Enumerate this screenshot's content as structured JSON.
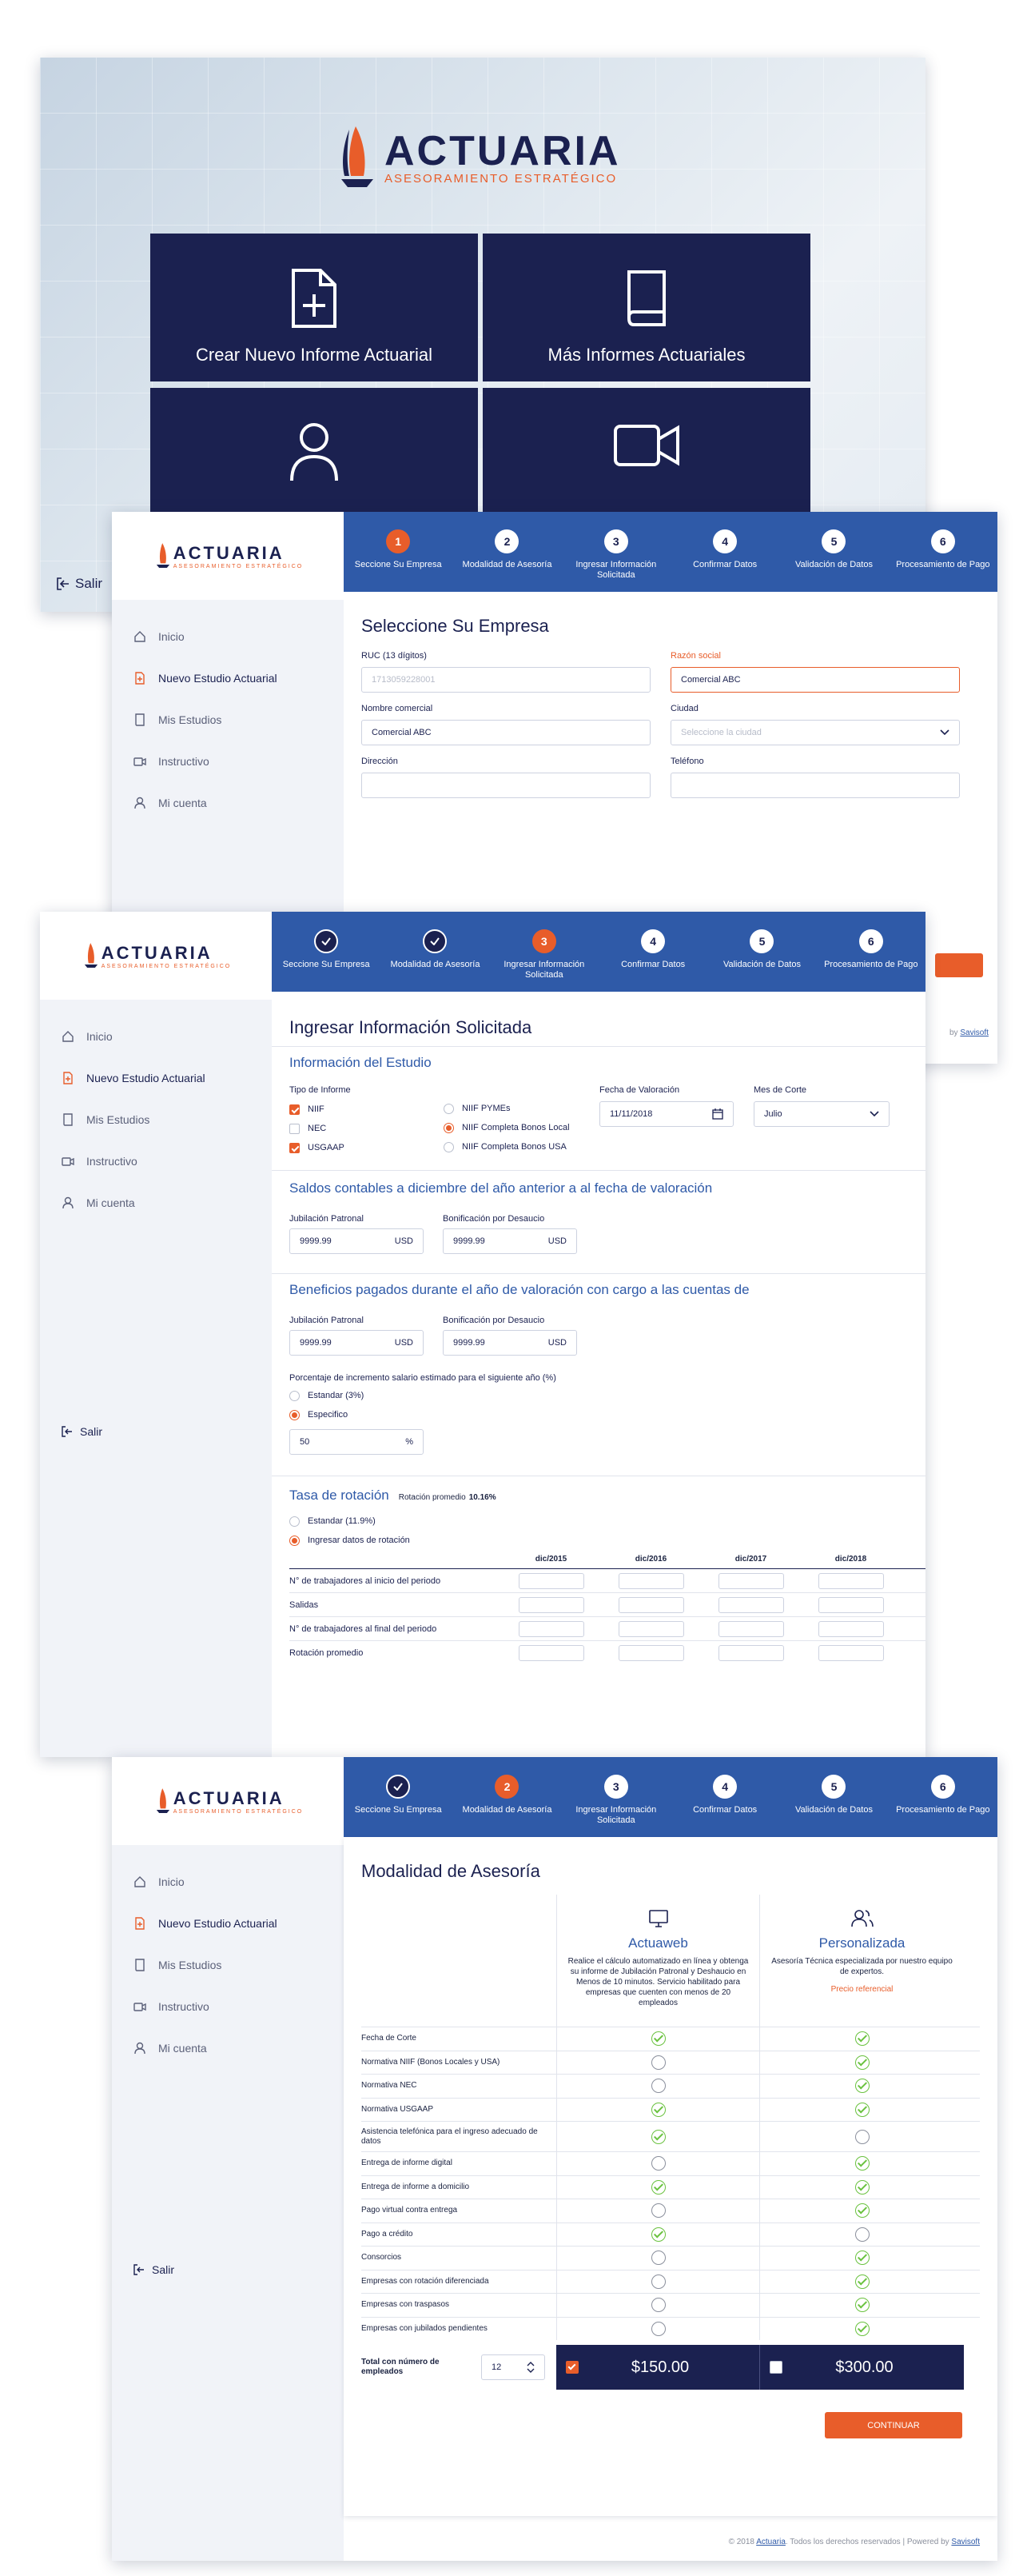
{
  "brand": {
    "name": "ACTUARIA",
    "tagline": "ASESORAMIENTO ESTRATÉGICO"
  },
  "home": {
    "tiles": [
      "Crear Nuevo Informe Actuarial",
      "Más Informes Actuariales",
      "",
      ""
    ],
    "logout": "Salir"
  },
  "steps": [
    "Seccione Su Empresa",
    "Modalidad de Asesoría",
    "Ingresar Información Solicitada",
    "Confirmar Datos",
    "Validación de Datos",
    "Procesamiento de Pago"
  ],
  "step_numbers": [
    "1",
    "2",
    "3",
    "4",
    "5",
    "6"
  ],
  "nav": [
    "Inicio",
    "Nuevo Estudio Actuarial",
    "Mis Estudios",
    "Instructivo",
    "Mi cuenta"
  ],
  "logout": "Salir",
  "empresa": {
    "title": "Seleccione Su Empresa",
    "ruc_label": "RUC (13 dígitos)",
    "ruc_placeholder": "1713059228001",
    "razon_label": "Razón social",
    "razon_value": "Comercial ABC",
    "nombre_label": "Nombre comercial",
    "nombre_value": "Comercial ABC",
    "ciudad_label": "Ciudad",
    "ciudad_placeholder": "Seleccione la ciudad",
    "direccion_label": "Dirección",
    "telefono_label": "Teléfono"
  },
  "info": {
    "title": "Ingresar Información Solicitada",
    "estudio_title": "Información del Estudio",
    "tipo_label": "Tipo de Informe",
    "tipos": [
      {
        "label": "NIIF",
        "checked": true
      },
      {
        "label": "NEC",
        "checked": false
      },
      {
        "label": "USGAAP",
        "checked": true
      }
    ],
    "tipos_radio": [
      {
        "label": "NIIF PYMEs",
        "checked": false
      },
      {
        "label": "NIIF Completa Bonos Local",
        "checked": true
      },
      {
        "label": "NIIF Completa Bonos USA",
        "checked": false
      }
    ],
    "fecha_label": "Fecha de Valoración",
    "fecha_value": "11/11/2018",
    "mes_label": "Mes de Corte",
    "mes_value": "Julio",
    "saldos_title": "Saldos contables a diciembre del año anterior a al fecha de valoración",
    "jub_label": "Jubilación Patronal",
    "bon_label": "Bonificación por Desaucio",
    "amount": "9999.99",
    "currency": "USD",
    "beneficios_title": "Beneficios pagados durante el año de valoración con cargo a las cuentas de",
    "pct_label": "Porcentaje de incremento salario estimado para el siguiente año (%)",
    "pct_opts": [
      {
        "label": "Estandar (3%)",
        "checked": false
      },
      {
        "label": "Especifico",
        "checked": true
      }
    ],
    "pct_value": "50",
    "pct_unit": "%",
    "rot_title": "Tasa de rotación",
    "rot_avg_label": "Rotación promedio",
    "rot_avg_value": "10.16%",
    "rot_opts": [
      {
        "label": "Estandar (11.9%)",
        "checked": false
      },
      {
        "label": "Ingresar datos de rotación",
        "checked": true
      }
    ],
    "rot_cols": [
      "dic/2015",
      "dic/2016",
      "dic/2017",
      "dic/2018"
    ],
    "rot_rows": [
      "N° de trabajadores al inicio del periodo",
      "Salidas",
      "N° de trabajadores al final del periodo",
      "Rotación promedio"
    ]
  },
  "modalidad": {
    "title": "Modalidad de Asesoría",
    "plans": [
      {
        "name": "Actuaweb",
        "desc": "Realice el cálculo automatizado en línea y obtenga su informe de Jubilación Patronal y Deshaucio en Menos de 10 minutos. Servicio habilitado para empresas que cuenten con menos de 20 empleados",
        "note": "",
        "price": "$150.00",
        "selected": true
      },
      {
        "name": "Personalizada",
        "desc": "Asesoría Técnica especializada por nuestro equipo de expertos.",
        "note": "Precio referencial",
        "price": "$300.00",
        "selected": false
      }
    ],
    "features": [
      {
        "label": "Fecha de Corte",
        "a": true,
        "b": true
      },
      {
        "label": "Normativa NIIF (Bonos Locales y USA)",
        "a": false,
        "b": true
      },
      {
        "label": "Normativa NEC",
        "a": false,
        "b": true
      },
      {
        "label": "Normativa USGAAP",
        "a": true,
        "b": true
      },
      {
        "label": "Asistencia telefónica para el ingreso adecuado de datos",
        "a": true,
        "b": false
      },
      {
        "label": "Entrega de informe digital",
        "a": false,
        "b": true
      },
      {
        "label": "Entrega de informe a domicilio",
        "a": true,
        "b": true
      },
      {
        "label": "Pago virtual contra entrega",
        "a": false,
        "b": true
      },
      {
        "label": "Pago a crédito",
        "a": true,
        "b": false
      },
      {
        "label": "Consorcios",
        "a": false,
        "b": true
      },
      {
        "label": "Empresas con rotación diferenciada",
        "a": false,
        "b": true
      },
      {
        "label": "Empresas con traspasos",
        "a": false,
        "b": true
      },
      {
        "label": "Empresas con jubilados pendientes",
        "a": false,
        "b": true
      }
    ],
    "total_label": "Total con número de empleados",
    "employees": "12",
    "continue": "CONTINUAR"
  },
  "footer": {
    "pre": "© 2018",
    "link": "Actuaria",
    "post": ". Todos los derechos reservados | Powered by",
    "powered": "Savisoft"
  },
  "colors": {
    "navy": "#1b2150",
    "blue": "#2f5aa8",
    "orange": "#e85d2a",
    "green": "#6ac23f"
  }
}
